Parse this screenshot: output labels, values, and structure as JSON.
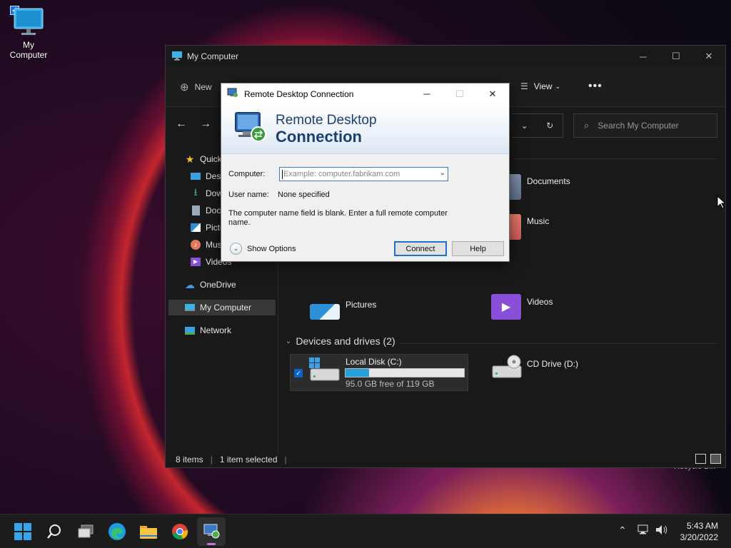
{
  "desktop": {
    "icon_label": "My Computer",
    "recycle_label": "Recycle Bin"
  },
  "explorer": {
    "title": "My Computer",
    "toolbar": {
      "new_label": "New",
      "view_label": "View",
      "more_label": "•••"
    },
    "search_placeholder": "Search My Computer",
    "sidebar": {
      "quick_access": "Quick access",
      "desktop": "Desktop",
      "downloads": "Downloads",
      "documents": "Documents",
      "pictures": "Pictures",
      "music": "Music",
      "videos": "Videos",
      "onedrive": "OneDrive",
      "my_computer": "My Computer",
      "network": "Network"
    },
    "folders": {
      "documents": "Documents",
      "music": "Music",
      "pictures": "Pictures",
      "videos": "Videos"
    },
    "devices_header": "Devices and drives (2)",
    "drive_c": {
      "name": "Local Disk (C:)",
      "free_text": "95.0 GB free of 119 GB",
      "used_fraction": 0.2
    },
    "drive_d": {
      "name": "CD Drive (D:)"
    },
    "status": {
      "items": "8 items",
      "selected": "1 item selected"
    }
  },
  "rdp": {
    "title": "Remote Desktop Connection",
    "banner_line1": "Remote Desktop",
    "banner_line2": "Connection",
    "computer_label": "Computer:",
    "computer_placeholder": "Example: computer.fabrikam.com",
    "username_label": "User name:",
    "username_value": "None specified",
    "message": "The computer name field is blank. Enter a full remote computer name.",
    "show_options": "Show Options",
    "connect": "Connect",
    "help": "Help"
  },
  "taskbar": {
    "time": "5:43 AM",
    "date": "3/20/2022"
  }
}
